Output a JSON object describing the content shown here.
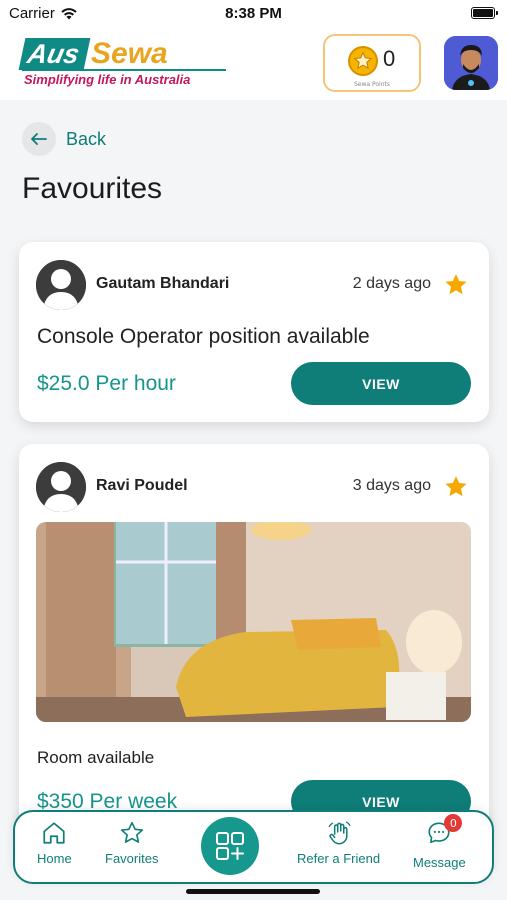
{
  "status_bar": {
    "carrier": "Carrier",
    "time": "8:38 PM"
  },
  "header": {
    "logo_aus": "Aus",
    "logo_sewa": "Sewa",
    "tagline": "Simplifying life in Australia",
    "points_count": "0",
    "points_caption": "Sewa Points"
  },
  "nav": {
    "back_label": "Back",
    "page_title": "Favourites"
  },
  "cards": [
    {
      "author": "Gautam Bhandari",
      "time": "2 days ago",
      "title": "Console Operator position available",
      "price": "$25.0 Per hour",
      "button": "VIEW",
      "favorited": true
    },
    {
      "author": "Ravi Poudel",
      "time": "3 days ago",
      "title": "Room available",
      "price": "$350 Per week",
      "button": "VIEW",
      "favorited": true
    }
  ],
  "bottom_nav": {
    "items": [
      {
        "label": "Home",
        "icon": "home-icon"
      },
      {
        "label": "Favorites",
        "icon": "star-outline-icon"
      },
      {
        "label": "",
        "icon": "add-post-icon"
      },
      {
        "label": "Refer a Friend",
        "icon": "wave-hand-icon"
      },
      {
        "label": "Message",
        "icon": "chat-icon",
        "badge": "0"
      }
    ]
  },
  "colors": {
    "primary": "#0f7d78",
    "accent_star": "#f4b400",
    "badge": "#e53935"
  }
}
